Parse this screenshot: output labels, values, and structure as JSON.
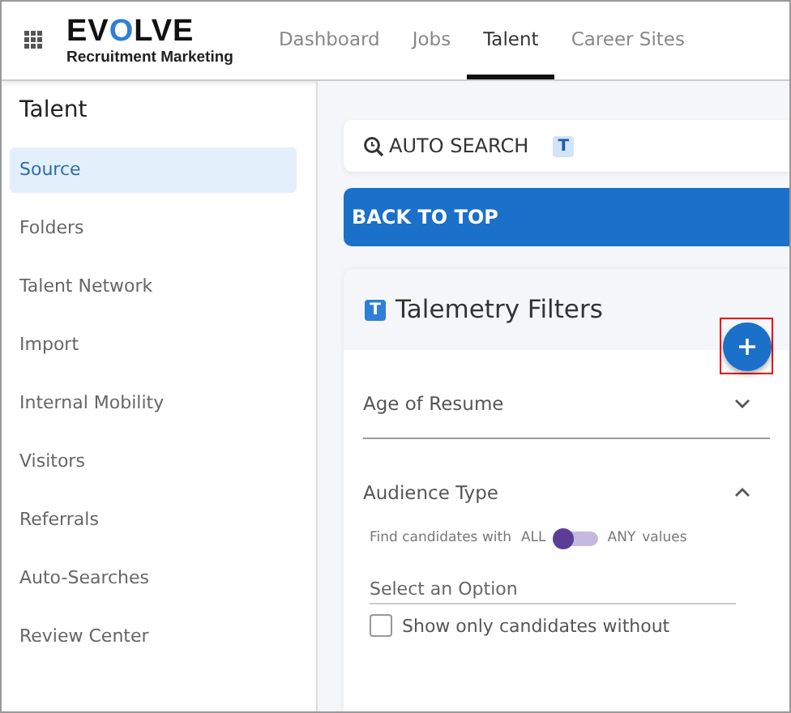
{
  "logo": {
    "before": "EV",
    "accent": "O",
    "after": "LVE",
    "tagline": "Recruitment Marketing"
  },
  "nav_tabs": [
    {
      "label": "Dashboard",
      "selected": false
    },
    {
      "label": "Jobs",
      "selected": false
    },
    {
      "label": "Talent",
      "selected": true
    },
    {
      "label": "Career Sites",
      "selected": false
    }
  ],
  "sidebar": {
    "title": "Talent",
    "items": [
      {
        "label": "Source",
        "selected": true
      },
      {
        "label": "Folders",
        "selected": false
      },
      {
        "label": "Talent Network",
        "selected": false
      },
      {
        "label": "Import",
        "selected": false
      },
      {
        "label": "Internal Mobility",
        "selected": false
      },
      {
        "label": "Visitors",
        "selected": false
      },
      {
        "label": "Referrals",
        "selected": false
      },
      {
        "label": "Auto-Searches",
        "selected": false
      },
      {
        "label": "Review Center",
        "selected": false
      }
    ]
  },
  "auto_search": {
    "label": "AUTO SEARCH",
    "badge": "T"
  },
  "back_to_top": "BACK TO TOP",
  "filters": {
    "badge": "T",
    "title": "Talemetry Filters",
    "sections": [
      {
        "title": "Age of Resume",
        "expanded": false
      },
      {
        "title": "Audience Type",
        "expanded": true,
        "match_prefix": "Find candidates with",
        "match_all": "ALL",
        "match_any": "ANY",
        "match_suffix": "values",
        "match_any_on": false,
        "placeholder": "Select an Option",
        "checkbox_label": "Show only candidates without",
        "checked": false
      }
    ]
  }
}
